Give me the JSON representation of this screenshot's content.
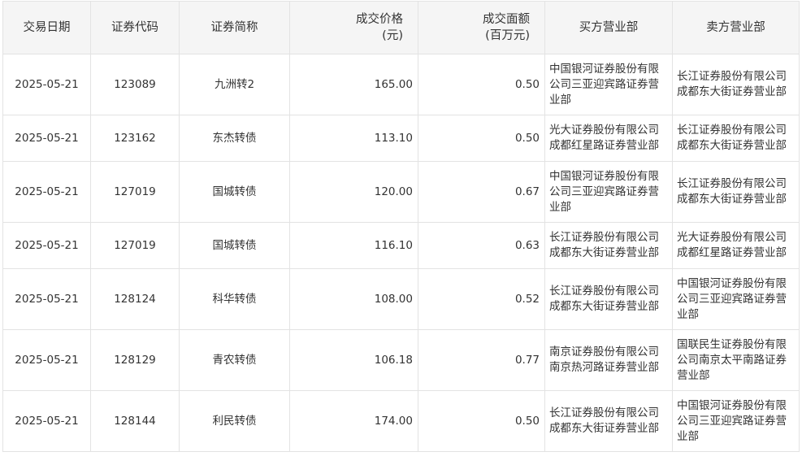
{
  "table": {
    "columns": [
      {
        "label": "交易日期",
        "unit": ""
      },
      {
        "label": "证券代码",
        "unit": ""
      },
      {
        "label": "证券简称",
        "unit": ""
      },
      {
        "label": "成交价格",
        "unit": "(元)"
      },
      {
        "label": "成交面额",
        "unit": "(百万元)"
      },
      {
        "label": "买方营业部",
        "unit": ""
      },
      {
        "label": "卖方营业部",
        "unit": ""
      }
    ],
    "rows": [
      {
        "date": "2025-05-21",
        "code": "123089",
        "name": "九洲转2",
        "price": "165.00",
        "amount": "0.50",
        "buyer": "中国银河证券股份有限公司三亚迎宾路证券营业部",
        "seller": "长江证券股份有限公司成都东大街证券营业部"
      },
      {
        "date": "2025-05-21",
        "code": "123162",
        "name": "东杰转债",
        "price": "113.10",
        "amount": "0.50",
        "buyer": "光大证券股份有限公司成都红星路证券营业部",
        "seller": "长江证券股份有限公司成都东大街证券营业部"
      },
      {
        "date": "2025-05-21",
        "code": "127019",
        "name": "国城转债",
        "price": "120.00",
        "amount": "0.67",
        "buyer": "中国银河证券股份有限公司三亚迎宾路证券营业部",
        "seller": "长江证券股份有限公司成都东大街证券营业部"
      },
      {
        "date": "2025-05-21",
        "code": "127019",
        "name": "国城转债",
        "price": "116.10",
        "amount": "0.63",
        "buyer": "长江证券股份有限公司成都东大街证券营业部",
        "seller": "光大证券股份有限公司成都红星路证券营业部"
      },
      {
        "date": "2025-05-21",
        "code": "128124",
        "name": "科华转债",
        "price": "108.00",
        "amount": "0.52",
        "buyer": "长江证券股份有限公司成都东大街证券营业部",
        "seller": "中国银河证券股份有限公司三亚迎宾路证券营业部"
      },
      {
        "date": "2025-05-21",
        "code": "128129",
        "name": "青农转债",
        "price": "106.18",
        "amount": "0.77",
        "buyer": "南京证券股份有限公司南京热河路证券营业部",
        "seller": "国联民生证券股份有限公司南京太平南路证券营业部"
      },
      {
        "date": "2025-05-21",
        "code": "128144",
        "name": "利民转债",
        "price": "174.00",
        "amount": "0.50",
        "buyer": "长江证券股份有限公司成都东大街证券营业部",
        "seller": "中国银河证券股份有限公司三亚迎宾路证券营业部"
      }
    ]
  }
}
